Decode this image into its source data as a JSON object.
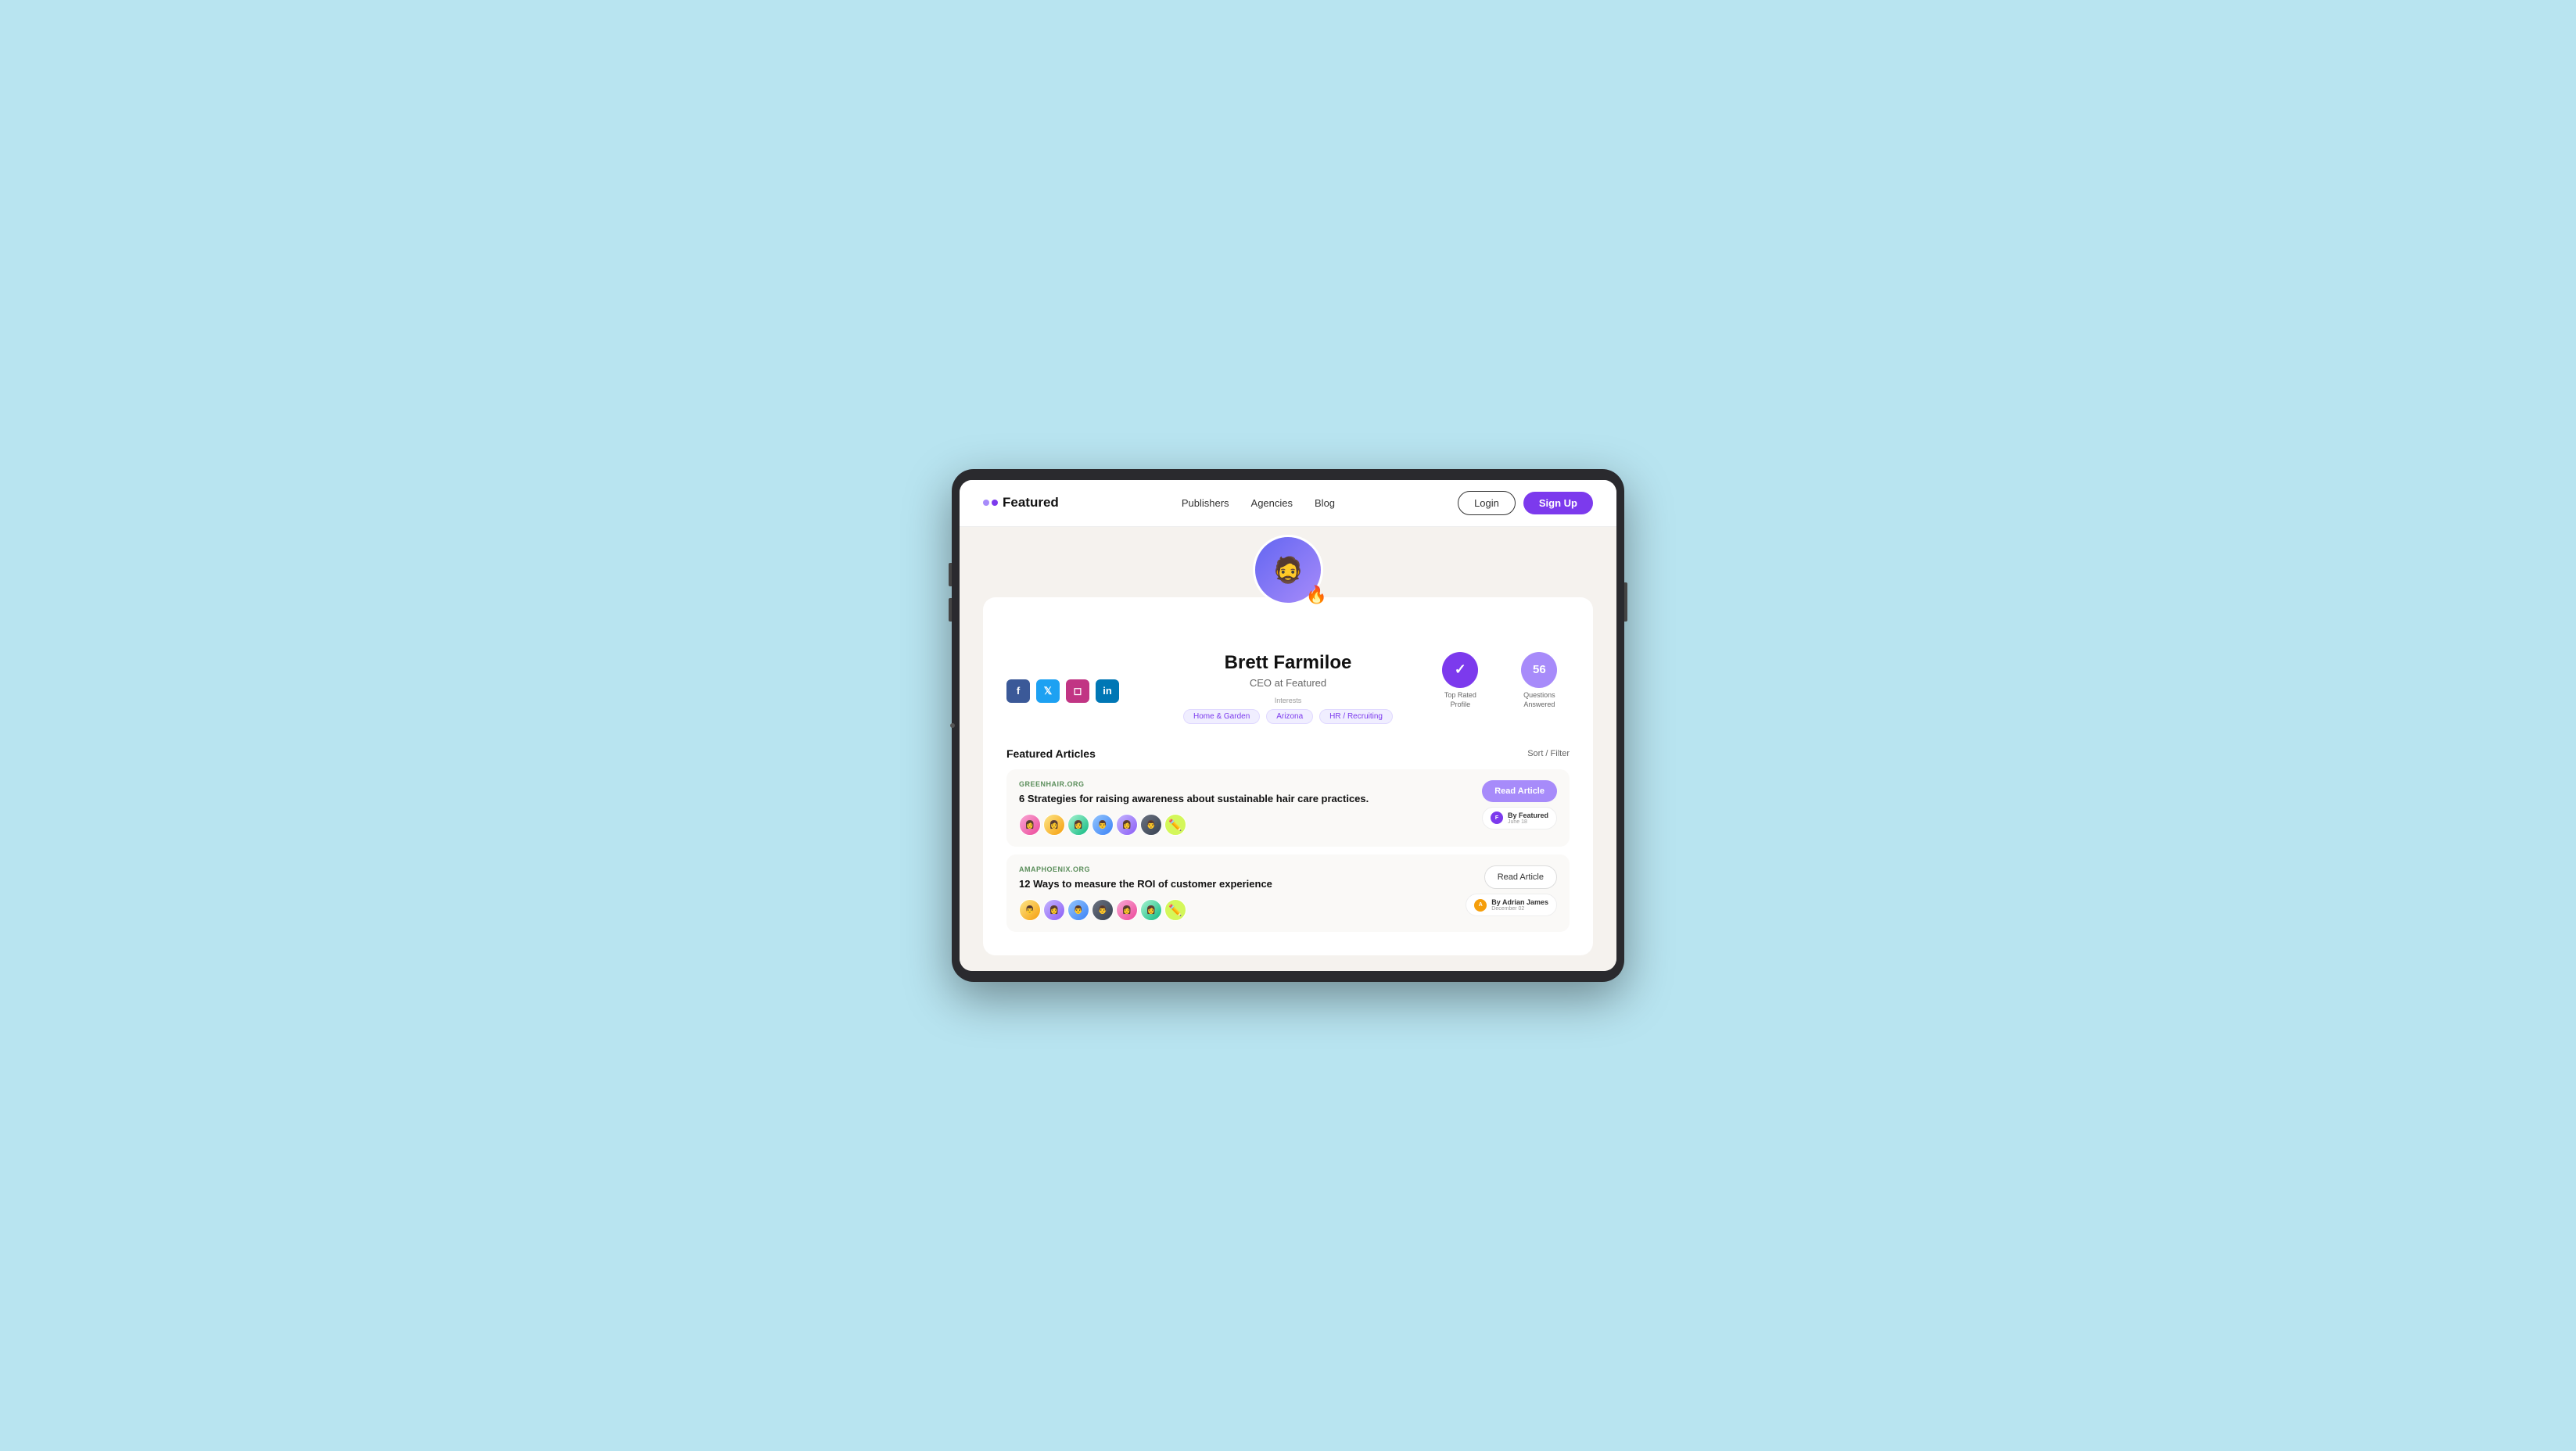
{
  "page": {
    "background": "#b8e4f0"
  },
  "nav": {
    "logo_text": "Featured",
    "links": [
      {
        "label": "Publishers",
        "href": "#"
      },
      {
        "label": "Agencies",
        "href": "#"
      },
      {
        "label": "Blog",
        "href": "#"
      }
    ],
    "login_label": "Login",
    "signup_label": "Sign Up"
  },
  "profile": {
    "name": "Brett Farmiloe",
    "title": "CEO at Featured",
    "interests_label": "Interests",
    "interests": [
      {
        "label": "Home & Garden"
      },
      {
        "label": "Arizona"
      },
      {
        "label": "HR / Recruiting"
      }
    ],
    "stats": {
      "top_rated": {
        "icon": "✓",
        "label": "Top Rated Profile"
      },
      "questions": {
        "count": "56",
        "label": "Questions Answered"
      }
    },
    "social": {
      "facebook": "f",
      "twitter": "t",
      "instagram": "in",
      "linkedin": "li"
    }
  },
  "articles": {
    "section_title": "Featured Articles",
    "sort_label": "Sort / Filter",
    "items": [
      {
        "source": "GREENHAIR.ORG",
        "title": "6 Strategies for raising awareness about sustainable hair care practices.",
        "read_btn": "Read Article",
        "publisher_by": "By Featured",
        "publisher_date": "June 18",
        "has_purple_btn": true
      },
      {
        "source": "AMAPHOENIX.ORG",
        "title": "12 Ways to measure the ROI of customer experience",
        "read_btn": "Read Article",
        "publisher_by": "By Adrian James",
        "publisher_date": "December 02",
        "has_purple_btn": false
      }
    ]
  }
}
